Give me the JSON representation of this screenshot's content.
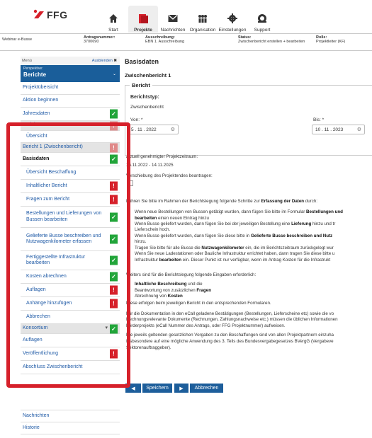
{
  "app": {
    "logo_text": "FFG"
  },
  "nav": [
    {
      "label": "Start",
      "icon": "home-icon"
    },
    {
      "label": "Projekte",
      "icon": "folder-icon",
      "active": true
    },
    {
      "label": "Nachrichten",
      "icon": "mail-icon"
    },
    {
      "label": "Organisation",
      "icon": "people-icon"
    },
    {
      "label": "Einstellungen",
      "icon": "gear-icon"
    },
    {
      "label": "Support",
      "icon": "support-icon"
    }
  ],
  "info": {
    "project": "Webinar e-Busse",
    "antrag_label": "Antragsnummer:",
    "antrag_value": "3700690",
    "aus_label": "Ausschreibung:",
    "aus_value": "EBN 1. Ausschreibung",
    "status_label": "Status:",
    "status_value": "Zwischenbericht erstellen + bearbeiten",
    "rolle_label": "Rolle:",
    "rolle_value": "Projektleiter (KF)"
  },
  "sidebar": {
    "menu_label": "Menü",
    "hide_label": "Ausblenden",
    "perspective_label": "Perspektive:",
    "perspective_value": "Berichte",
    "items": [
      {
        "label": "Projektübersicht",
        "badge": ""
      },
      {
        "label": "Aktion beginnen",
        "badge": ""
      },
      {
        "label": "Jahresdaten",
        "badge": "ok"
      },
      {
        "label": "Berichte",
        "badge": "errl",
        "style": "gray"
      },
      {
        "label": "Übersicht",
        "badge": "",
        "style": "sub"
      },
      {
        "label": "Bericht 1 (Zwischenbericht)",
        "badge": "errl",
        "style": "gray"
      },
      {
        "label": "Basisdaten",
        "badge": "ok",
        "style": "bold"
      },
      {
        "label": "Übersicht Beschaffung",
        "badge": "",
        "style": "sub"
      },
      {
        "label": "Inhaltlicher Bericht",
        "badge": "err",
        "style": "sub"
      },
      {
        "label": "Fragen zum Bericht",
        "badge": "err",
        "style": "sub"
      },
      {
        "label": "Bestellungen und Lieferungen von Bussen bearbeiten",
        "badge": "ok",
        "style": "sub"
      },
      {
        "label": "Gelieferte Busse beschreiben und Nutzwagenkilometer erfassen",
        "badge": "ok",
        "style": "sub"
      },
      {
        "label": "Fertiggestellte Infrastruktur bearbeiten",
        "badge": "ok",
        "style": "sub"
      },
      {
        "label": "Kosten abrechnen",
        "badge": "ok",
        "style": "sub"
      },
      {
        "label": "Auflagen",
        "badge": "err",
        "style": "sub"
      },
      {
        "label": "Anhänge hinzufügen",
        "badge": "err",
        "style": "sub"
      },
      {
        "label": "Abbrechen",
        "badge": "",
        "style": "sub"
      },
      {
        "label": "Konsortium",
        "badge": "ok",
        "style": "gray"
      },
      {
        "label": "Auflagen",
        "badge": ""
      },
      {
        "label": "Veröffentlichung",
        "badge": "err"
      },
      {
        "label": "Abschluss Zwischenbericht",
        "badge": ""
      }
    ],
    "footer": [
      "Nachrichten",
      "Historie"
    ]
  },
  "main": {
    "title": "Basisdaten",
    "subtitle": "Zwischenbericht 1",
    "fieldset": "Bericht",
    "berichtstyp_label": "Berichtstyp:",
    "berichtstyp_value": "Zwischenbericht",
    "von_label": "Von: *",
    "von_value": "5 . 11 . 2022",
    "bis_label": "Bis: *",
    "bis_value": "10 . 11 . 2023",
    "zeitraum_label": "Aktuell genehmigter Projektzeitraum:",
    "zeitraum_value": "15.11.2022 - 14.11.2025",
    "verschiebung": "Verschiebung des Projektendes beantragen:",
    "lines": [
      "Führen Sie bitte im Rahmen der Berichtslegung folgende Schritte zur Erfassung der Daten durch:",
      "Wenn neue Bestellungen von Bussen getätigt wurden, dann fügen Sie bitte im Formular Bestellungen und",
      "bearbeiten einen neuen Eintrag hinzu",
      "Wenn Busse geliefert wurden, dann fügen Sie bei der jeweiligen Bestellung eine Lieferung hinzu und tr",
      "Lieferschein hoch.",
      "Wenn Busse geliefert wurden, dann fügen Sie diese bitte in Gelieferte Busse beschreiben und Nutz",
      "hinzu.",
      "Tragen Sie bitte für alle Busse die Nutzwagenkilometer ein, die im Berichtszeitraum zurückgelegt wur",
      "Wenn Sie neue Ladestationen oder Bauliche Infrastruktur errichtet haben, dann tragen Sie diese bitte u",
      "Infrastruktur bearbeiten ein. Dieser Punkt ist nur verfügbar, wenn im Antrag Kosten für die Infrastrukt",
      "Weiters sind für die Berichtslegung folgende Eingaben erforderlich:",
      "Inhaltliche Beschreibung und die",
      "Beantwortung von zusätzlichen Fragen",
      "Abrechnung von Kosten",
      "Diese erfolgen beim jeweiligen Bericht in den entsprechenden Formularen.",
      "Für die Dokumentation in den eCall geladene Bestätigungen (Bestellungen, Lieferscheine etc) sowie die vo",
      "Rechnungsrelevante Dokumente (Rechnungen, Zahlungsnachweise etc.) müssen die üblichen Informationen",
      "Förderprojekts (eCall Nummer des Antrags, oder FFG Projektnummer) aufweisen.",
      "Die jeweils geltenden gesetzlichen Vorgaben zu den Beschaffungen sind von allen Projektpartnern einzuha",
      "Insbesondere auf eine mögliche Anwendung des 3. Teils des Bundesvergabegesetzes BVergG (Vergabeve",
      "Sektorenauftraggeber)."
    ],
    "save_label": "Speichern",
    "cancel_label": "Abbrechen"
  },
  "colors": {
    "brand": "#1a5e9a",
    "ok": "#22a53a",
    "error": "#d6202a",
    "highlight": "#d6202a"
  }
}
